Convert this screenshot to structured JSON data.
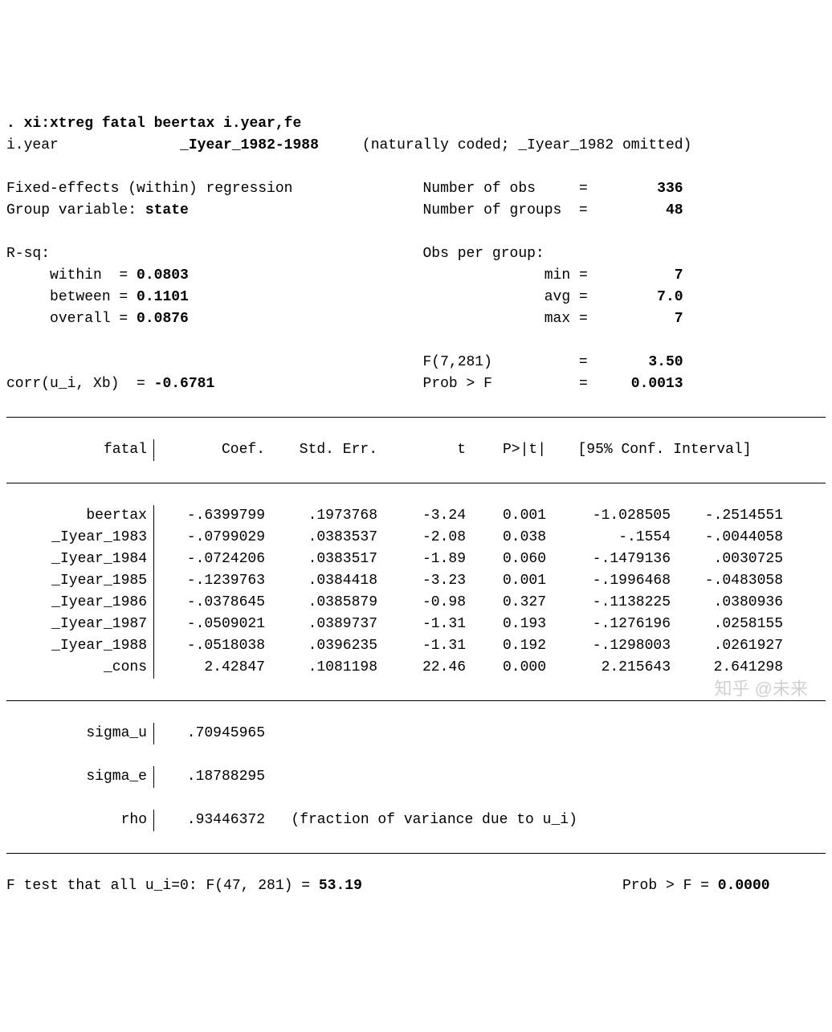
{
  "cmd": ". xi:xtreg fatal beertax i.year,fe",
  "xi_var": "i.year",
  "xi_stub": "_Iyear_1982-1988",
  "xi_note": "(naturally coded; _Iyear_1982 omitted)",
  "model_line": "Fixed-effects (within) regression",
  "grpvar_lbl": "Group variable: ",
  "grpvar": "state",
  "nobs_lbl": "Number of obs",
  "nobs": "336",
  "ngrp_lbl": "Number of groups",
  "ngrp": "48",
  "rsq_lbl": "R-sq:",
  "rsq_within_lbl": "within  = ",
  "rsq_within": "0.0803",
  "rsq_between_lbl": "between = ",
  "rsq_between": "0.1101",
  "rsq_overall_lbl": "overall = ",
  "rsq_overall": "0.0876",
  "opg_lbl": "Obs per group:",
  "opg_min_lbl": "min =",
  "opg_min": "7",
  "opg_avg_lbl": "avg =",
  "opg_avg": "7.0",
  "opg_max_lbl": "max =",
  "opg_max": "7",
  "fstat_lbl": "F(7,281)",
  "fstat": "3.50",
  "corr_lbl": "corr(u_i, Xb)  = ",
  "corr": "-0.6781",
  "probf_lbl": "Prob > F",
  "probf": "0.0013",
  "depvar": "fatal",
  "hdr": {
    "coef": "Coef.",
    "se": "Std. Err.",
    "t": "t",
    "p": "P>|t|",
    "ci": "[95% Conf. Interval]"
  },
  "rows": [
    {
      "v": "beertax",
      "coef": "-.6399799",
      "se": ".1973768",
      "t": "-3.24",
      "p": "0.001",
      "lo": "-1.028505",
      "hi": "-.2514551"
    },
    {
      "v": "_Iyear_1983",
      "coef": "-.0799029",
      "se": ".0383537",
      "t": "-2.08",
      "p": "0.038",
      "lo": "-.1554",
      "hi": "-.0044058"
    },
    {
      "v": "_Iyear_1984",
      "coef": "-.0724206",
      "se": ".0383517",
      "t": "-1.89",
      "p": "0.060",
      "lo": "-.1479136",
      "hi": ".0030725"
    },
    {
      "v": "_Iyear_1985",
      "coef": "-.1239763",
      "se": ".0384418",
      "t": "-3.23",
      "p": "0.001",
      "lo": "-.1996468",
      "hi": "-.0483058"
    },
    {
      "v": "_Iyear_1986",
      "coef": "-.0378645",
      "se": ".0385879",
      "t": "-0.98",
      "p": "0.327",
      "lo": "-.1138225",
      "hi": ".0380936"
    },
    {
      "v": "_Iyear_1987",
      "coef": "-.0509021",
      "se": ".0389737",
      "t": "-1.31",
      "p": "0.193",
      "lo": "-.1276196",
      "hi": ".0258155"
    },
    {
      "v": "_Iyear_1988",
      "coef": "-.0518038",
      "se": ".0396235",
      "t": "-1.31",
      "p": "0.192",
      "lo": "-.1298003",
      "hi": ".0261927"
    },
    {
      "v": "_cons",
      "coef": "2.42847",
      "se": ".1081198",
      "t": "22.46",
      "p": "0.000",
      "lo": "2.215643",
      "hi": "2.641298"
    }
  ],
  "sigu_lbl": "sigma_u",
  "sigu": ".70945965",
  "sige_lbl": "sigma_e",
  "sige": ".18788295",
  "rho_lbl": "rho",
  "rho": ".93446372",
  "rho_note": "(fraction of variance due to u_i)",
  "ftest_lbl": "F test that all u_i=0: F(47, 281) = ",
  "ftest_val": "53.19",
  "ftest_plbl": "Prob > F = ",
  "ftest_p": "0.0000",
  "watermark": "知乎 @未来"
}
